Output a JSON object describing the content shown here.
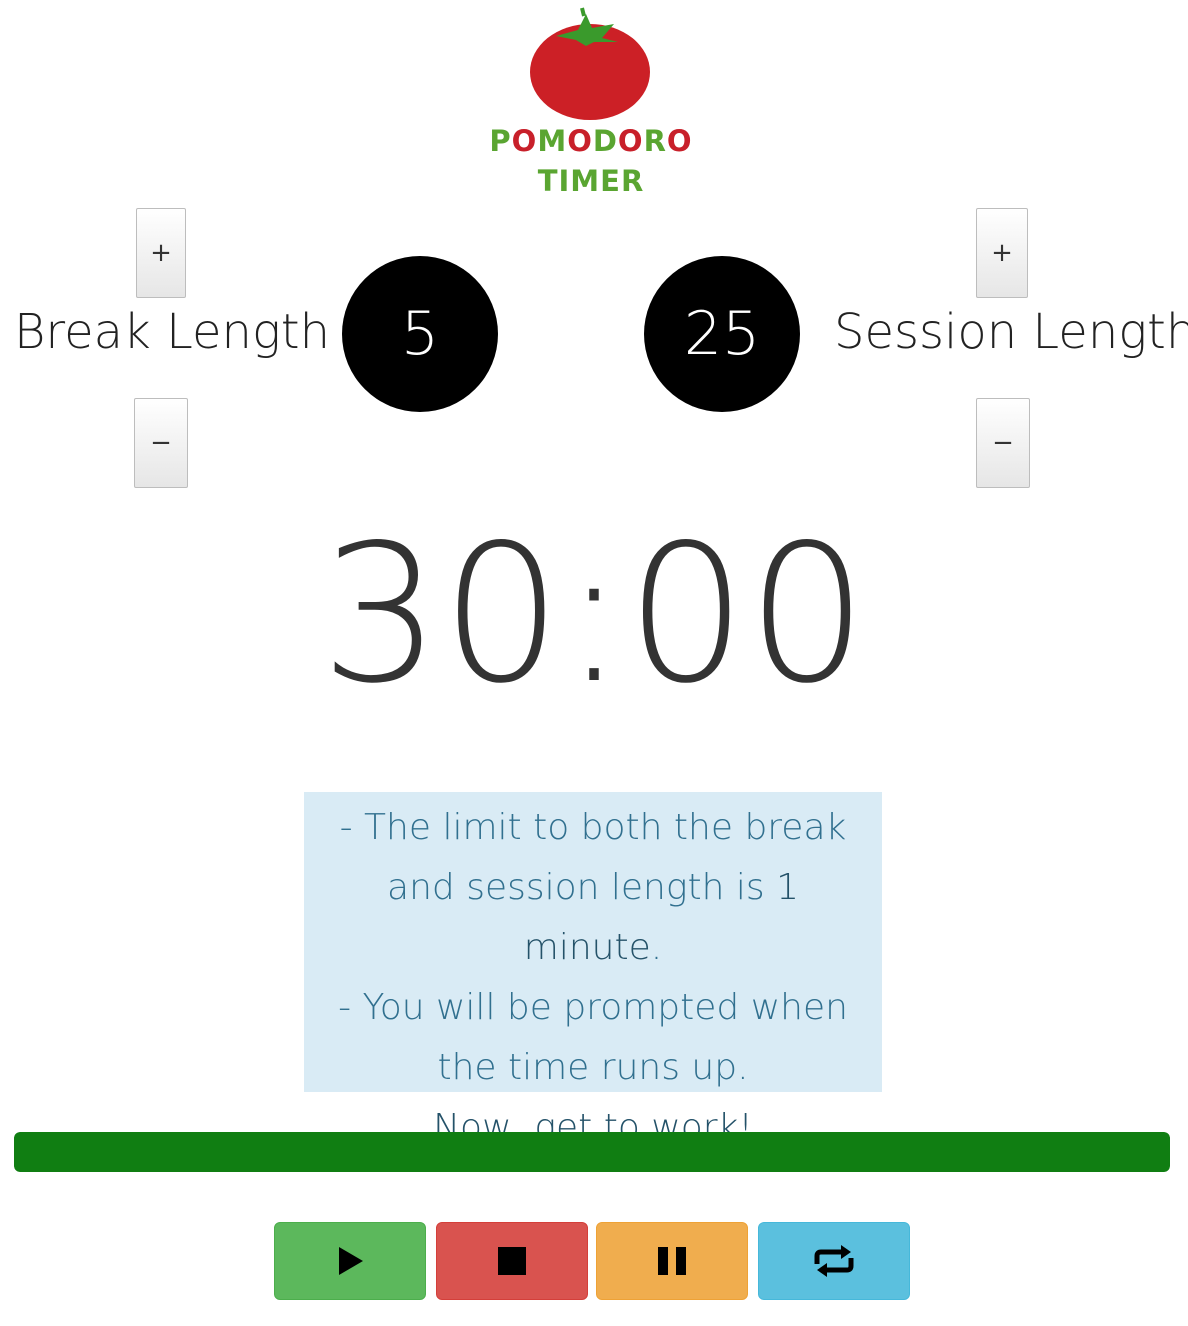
{
  "logo": {
    "word1_letters": [
      "P",
      "O",
      "M",
      "O",
      "D",
      "O",
      "R",
      "O"
    ],
    "word2": "TIMER",
    "green": "#5aa531",
    "red": "#c8202a"
  },
  "break": {
    "label": "Break Length",
    "value": "5",
    "increment_label": "+",
    "decrement_label": "−"
  },
  "session": {
    "label": "Session Length",
    "value": "25",
    "increment_label": "+",
    "decrement_label": "−"
  },
  "timer": {
    "display": "30:00"
  },
  "info": {
    "line1": "- The limit to both the break",
    "line2_prefix": "and session length is ",
    "line2_strong": "1 minute",
    "line2_suffix": ".",
    "line3": "- You will be prompted when",
    "line4": "the time runs up.",
    "line5": "Now, get to work!"
  },
  "progress": {
    "fraction": 1.0,
    "color": "#107e12"
  },
  "controls": {
    "play": {
      "icon": "play-icon",
      "color": "#5cb85c"
    },
    "stop": {
      "icon": "stop-icon",
      "color": "#d9534f"
    },
    "pause": {
      "icon": "pause-icon",
      "color": "#f0ad4e"
    },
    "reset": {
      "icon": "repeat-icon",
      "color": "#5bc0de"
    }
  }
}
